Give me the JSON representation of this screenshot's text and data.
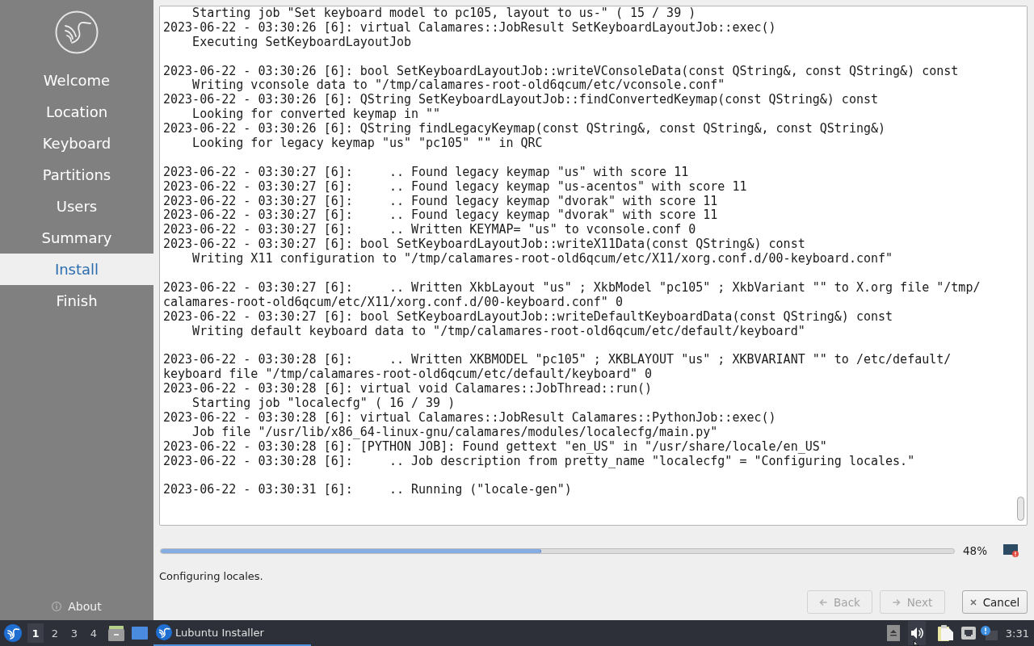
{
  "sidebar": {
    "steps": [
      {
        "label": "Welcome",
        "selected": false
      },
      {
        "label": "Location",
        "selected": false
      },
      {
        "label": "Keyboard",
        "selected": false
      },
      {
        "label": "Partitions",
        "selected": false
      },
      {
        "label": "Users",
        "selected": false
      },
      {
        "label": "Summary",
        "selected": false
      },
      {
        "label": "Install",
        "selected": true
      },
      {
        "label": "Finish",
        "selected": false
      }
    ],
    "about": {
      "label": "About"
    }
  },
  "log": {
    "blocks": [
      [
        {
          "kind": "indented",
          "text": "Starting job \"Set keyboard model to pc105, layout to us-\" ( 15 / 39 )"
        },
        {
          "kind": "plain",
          "text": "2023-06-22 - 03:30:26 [6]: virtual Calamares::JobResult SetKeyboardLayoutJob::exec()"
        },
        {
          "kind": "indented",
          "text": "Executing SetKeyboardLayoutJob"
        }
      ],
      [
        {
          "kind": "plain",
          "text": "2023-06-22 - 03:30:26 [6]: bool SetKeyboardLayoutJob::writeVConsoleData(const QString&, const QString&) const"
        },
        {
          "kind": "indented",
          "text": "Writing vconsole data to \"/tmp/calamares-root-old6qcum/etc/vconsole.conf\""
        },
        {
          "kind": "plain",
          "text": "2023-06-22 - 03:30:26 [6]: QString SetKeyboardLayoutJob::findConvertedKeymap(const QString&) const"
        },
        {
          "kind": "indented",
          "text": "Looking for converted keymap in \"\""
        },
        {
          "kind": "plain",
          "text": "2023-06-22 - 03:30:26 [6]: QString findLegacyKeymap(const QString&, const QString&, const QString&)"
        },
        {
          "kind": "indented",
          "text": "Looking for legacy keymap \"us\" \"pc105\" \"\" in QRC"
        }
      ],
      [
        {
          "kind": "plain",
          "text": "2023-06-22 - 03:30:27 [6]:     .. Found legacy keymap \"us\" with score 11"
        },
        {
          "kind": "plain",
          "text": "2023-06-22 - 03:30:27 [6]:     .. Found legacy keymap \"us-acentos\" with score 11"
        },
        {
          "kind": "plain",
          "text": "2023-06-22 - 03:30:27 [6]:     .. Found legacy keymap \"dvorak\" with score 11"
        },
        {
          "kind": "plain",
          "text": "2023-06-22 - 03:30:27 [6]:     .. Found legacy keymap \"dvorak\" with score 11"
        },
        {
          "kind": "plain",
          "text": "2023-06-22 - 03:30:27 [6]:     .. Written KEYMAP= \"us\" to vconsole.conf 0"
        },
        {
          "kind": "plain",
          "text": "2023-06-22 - 03:30:27 [6]: bool SetKeyboardLayoutJob::writeX11Data(const QString&) const"
        },
        {
          "kind": "indented",
          "text": "Writing X11 configuration to \"/tmp/calamares-root-old6qcum/etc/X11/xorg.conf.d/00-keyboard.conf\""
        }
      ],
      [
        {
          "kind": "plain",
          "text": "2023-06-22 - 03:30:27 [6]:     .. Written XkbLayout \"us\" ; XkbModel \"pc105\" ; XkbVariant \"\" to X.org file \"/tmp/"
        },
        {
          "kind": "plain",
          "text": "calamares-root-old6qcum/etc/X11/xorg.conf.d/00-keyboard.conf\" 0"
        },
        {
          "kind": "plain",
          "text": "2023-06-22 - 03:30:27 [6]: bool SetKeyboardLayoutJob::writeDefaultKeyboardData(const QString&) const"
        },
        {
          "kind": "indented",
          "text": "Writing default keyboard data to \"/tmp/calamares-root-old6qcum/etc/default/keyboard\""
        }
      ],
      [
        {
          "kind": "plain",
          "text": "2023-06-22 - 03:30:28 [6]:     .. Written XKBMODEL \"pc105\" ; XKBLAYOUT \"us\" ; XKBVARIANT \"\" to /etc/default/"
        },
        {
          "kind": "plain",
          "text": "keyboard file \"/tmp/calamares-root-old6qcum/etc/default/keyboard\" 0"
        },
        {
          "kind": "plain",
          "text": "2023-06-22 - 03:30:28 [6]: virtual void Calamares::JobThread::run()"
        },
        {
          "kind": "indented",
          "text": "Starting job \"localecfg\" ( 16 / 39 )"
        },
        {
          "kind": "plain",
          "text": "2023-06-22 - 03:30:28 [6]: virtual Calamares::JobResult Calamares::PythonJob::exec()"
        },
        {
          "kind": "indented",
          "text": "Job file \"/usr/lib/x86_64-linux-gnu/calamares/modules/localecfg/main.py\""
        },
        {
          "kind": "plain",
          "text": "2023-06-22 - 03:30:28 [6]: [PYTHON JOB]: Found gettext \"en_US\" in \"/usr/share/locale/en_US\""
        },
        {
          "kind": "plain",
          "text": "2023-06-22 - 03:30:28 [6]:     .. Job description from pretty_name \"localecfg\" = \"Configuring locales.\""
        }
      ],
      [
        {
          "kind": "plain",
          "text": "2023-06-22 - 03:30:31 [6]:     .. Running (\"locale-gen\")"
        }
      ]
    ]
  },
  "progress": {
    "level": 0.48,
    "reading": "48%"
  },
  "status": "Configuring locales.",
  "buttons": [
    {
      "kind": "back",
      "label": "Back",
      "disabled": true
    },
    {
      "kind": "next",
      "label": "Next",
      "disabled": true
    },
    {
      "kind": "cancel",
      "label": "Cancel",
      "disabled": false
    }
  ],
  "taskbar": {
    "desktops": [
      {
        "label": "1",
        "selected": true
      },
      {
        "label": "2",
        "selected": false
      },
      {
        "label": "3",
        "selected": false
      },
      {
        "label": "4",
        "selected": false
      }
    ],
    "task": {
      "label": "Lubuntu Installer",
      "selected": true
    },
    "clock": "3:31"
  }
}
